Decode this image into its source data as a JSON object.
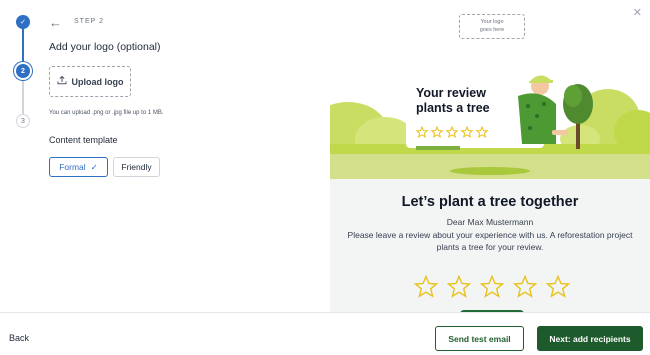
{
  "stepper": {
    "steps": [
      {
        "state": "done",
        "mark": "✓"
      },
      {
        "state": "current",
        "mark": "2"
      },
      {
        "state": "upcoming",
        "mark": "3"
      }
    ]
  },
  "header": {
    "step_label": "STEP 2",
    "back_icon": "arrow-left-icon",
    "close_icon": "close-icon"
  },
  "form": {
    "section_title": "Add your logo (optional)",
    "upload_label": "Upload logo",
    "upload_icon": "upload-icon",
    "hint": "You can upload .png or .jpg file up to 1 MB.",
    "template_title": "Content template",
    "templates": [
      {
        "label": "Formal",
        "selected": true,
        "check": "✓"
      },
      {
        "label": "Friendly",
        "selected": false
      }
    ]
  },
  "preview": {
    "logo_placeholder_line1": "Your logo",
    "logo_placeholder_line2": "goes here",
    "card_line1": "Your review",
    "card_line2": "plants a tree",
    "title": "Let’s plant a tree together",
    "greeting": "Dear Max Mustermann",
    "body_line1": "Please leave a review about your experience with us. A reforestation project",
    "body_line2": "plants a tree for your review.",
    "star_count": 5
  },
  "footer": {
    "back_label": "Back",
    "send_test_label": "Send test email",
    "next_label": "Next: add recipients"
  },
  "colors": {
    "accent_blue": "#2f6fc4",
    "brand_green": "#1d5a2c",
    "lime": "#bfd94a",
    "star_yellow": "#e8c21a"
  }
}
